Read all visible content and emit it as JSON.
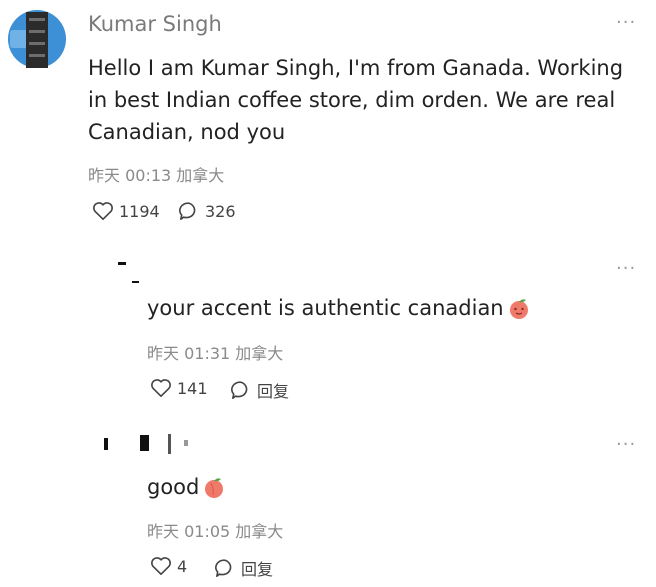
{
  "comment": {
    "author": "Kumar Singh",
    "text": "Hello I am Kumar Singh, I'm from Ganada. Working in best Indian coffee store, dim orden. We are real Canadian, nod you",
    "time": "昨天 00:13",
    "location": "加拿大",
    "likes": "1194",
    "replies_count": "326",
    "more_label": "···"
  },
  "replies": [
    {
      "text": "your accent is authentic canadian",
      "emoji": "peach-emoji",
      "time": "昨天 01:31",
      "location": "加拿大",
      "likes": "141",
      "reply_label": "回复",
      "more_label": "···"
    },
    {
      "text": "good",
      "emoji": "peach-emoji",
      "time": "昨天 01:05",
      "location": "加拿大",
      "likes": "4",
      "reply_label": "回复",
      "more_label": "···"
    }
  ],
  "colors": {
    "avatar_blue": "#3d8fd6",
    "peach": "#f07a6a",
    "muted": "#8a8a8a"
  }
}
